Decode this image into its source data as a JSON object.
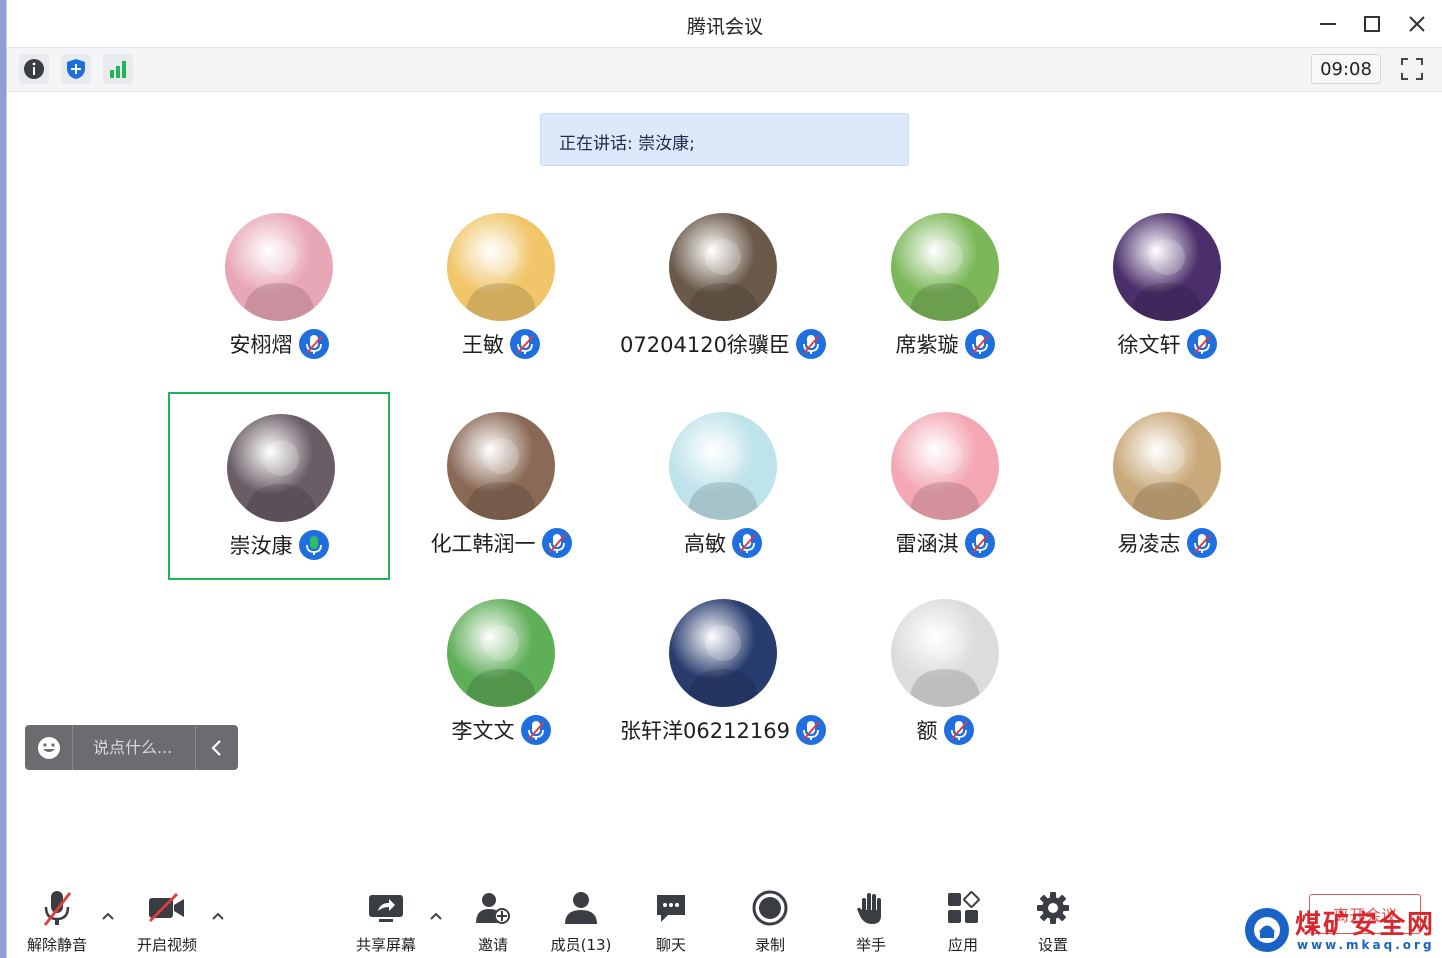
{
  "window": {
    "title": "腾讯会议",
    "timer": "09:08"
  },
  "banner": {
    "speaking_text": "正在讲话: 崇汝康;"
  },
  "participants": [
    {
      "name": "安栩熠",
      "mic": "muted",
      "avatar_color": "#e8a7b6"
    },
    {
      "name": "王敏",
      "mic": "muted",
      "avatar_color": "#f1c66a"
    },
    {
      "name": "07204120徐骥臣",
      "mic": "muted",
      "avatar_color": "#6b5a4a"
    },
    {
      "name": "席紫璇",
      "mic": "muted",
      "avatar_color": "#7cb85a"
    },
    {
      "name": "徐文轩",
      "mic": "muted",
      "avatar_color": "#4b2f6b"
    },
    {
      "name": "崇汝康",
      "mic": "speaking",
      "avatar_color": "#6b5d66"
    },
    {
      "name": "化工韩润一",
      "mic": "muted",
      "avatar_color": "#8a6a56"
    },
    {
      "name": "高敏",
      "mic": "muted",
      "avatar_color": "#bfe3ea"
    },
    {
      "name": "雷涵淇",
      "mic": "muted",
      "avatar_color": "#f3a8b4"
    },
    {
      "name": "易凌志",
      "mic": "muted",
      "avatar_color": "#c9a97a"
    },
    {
      "name": "李文文",
      "mic": "muted",
      "avatar_color": "#5fae58"
    },
    {
      "name": "张轩洋06212169",
      "mic": "muted",
      "avatar_color": "#283c6e"
    },
    {
      "name": "额",
      "mic": "muted",
      "avatar_color": "#dcdcdc"
    }
  ],
  "chat": {
    "placeholder": "说点什么..."
  },
  "bottom": {
    "unmute": "解除静音",
    "video": "开启视频",
    "share": "共享屏幕",
    "invite": "邀请",
    "members": "成员(13)",
    "chat": "聊天",
    "record": "录制",
    "raise_hand": "举手",
    "apps": "应用",
    "settings": "设置",
    "leave": "离开会议"
  },
  "watermark": {
    "text": "煤矿安全网",
    "url": "www.mkaq.org"
  },
  "colors": {
    "active_border": "#1db45a",
    "mic_blue": "#1f6fe0",
    "mic_green": "#2fbf5d",
    "banner_bg": "#dde9fb"
  }
}
